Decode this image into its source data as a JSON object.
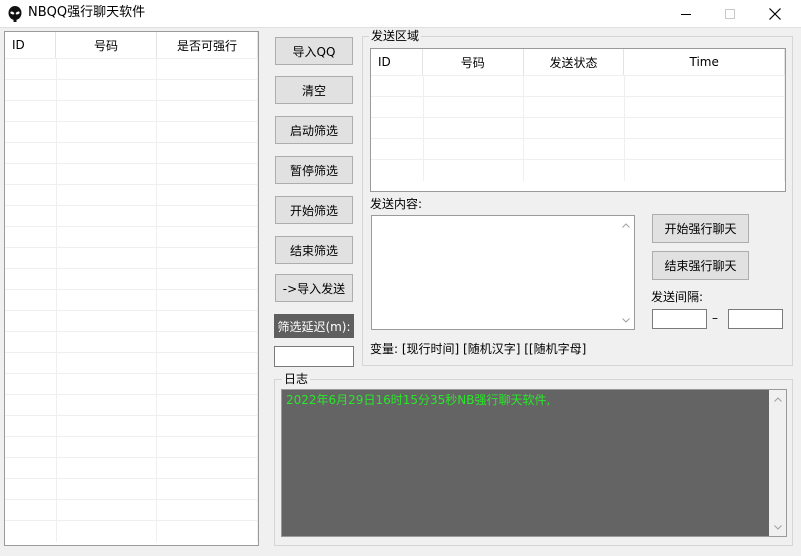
{
  "window": {
    "title": "NBQQ强行聊天软件",
    "minimize_icon": "minimize-icon",
    "maximize_icon": "maximize-icon",
    "close_icon": "close-icon",
    "app_icon": "alien-icon"
  },
  "left_list": {
    "columns": [
      "ID",
      "号码",
      "是否可强行"
    ],
    "rows": []
  },
  "buttons": {
    "import_qq": "导入QQ",
    "clear": "清空",
    "start_filter": "启动筛选",
    "pause_filter": "暂停筛选",
    "begin_filter": "开始筛选",
    "end_filter": "结束筛选",
    "import_send": "->导入发送",
    "start_chat": "开始强行聊天",
    "end_chat": "结束强行聊天"
  },
  "filter_delay": {
    "label": "筛选延迟(m):",
    "value": ""
  },
  "send_area": {
    "title": "发送区域",
    "columns": [
      "ID",
      "号码",
      "发送状态",
      "Time"
    ],
    "rows": []
  },
  "send_content": {
    "label": "发送内容:",
    "value": ""
  },
  "send_interval": {
    "label": "发送间隔:",
    "from": "",
    "separator": "–",
    "to": ""
  },
  "variables": {
    "text": "变量: [现行时间] [随机汉字] [[随机字母]"
  },
  "log": {
    "title": "日志",
    "lines": [
      "2022年6月29日16时15分35秒NB强行聊天软件,"
    ]
  },
  "colors": {
    "log_background": "#646464",
    "log_text": "#27e827",
    "dark_label": "#5f5f5f"
  }
}
